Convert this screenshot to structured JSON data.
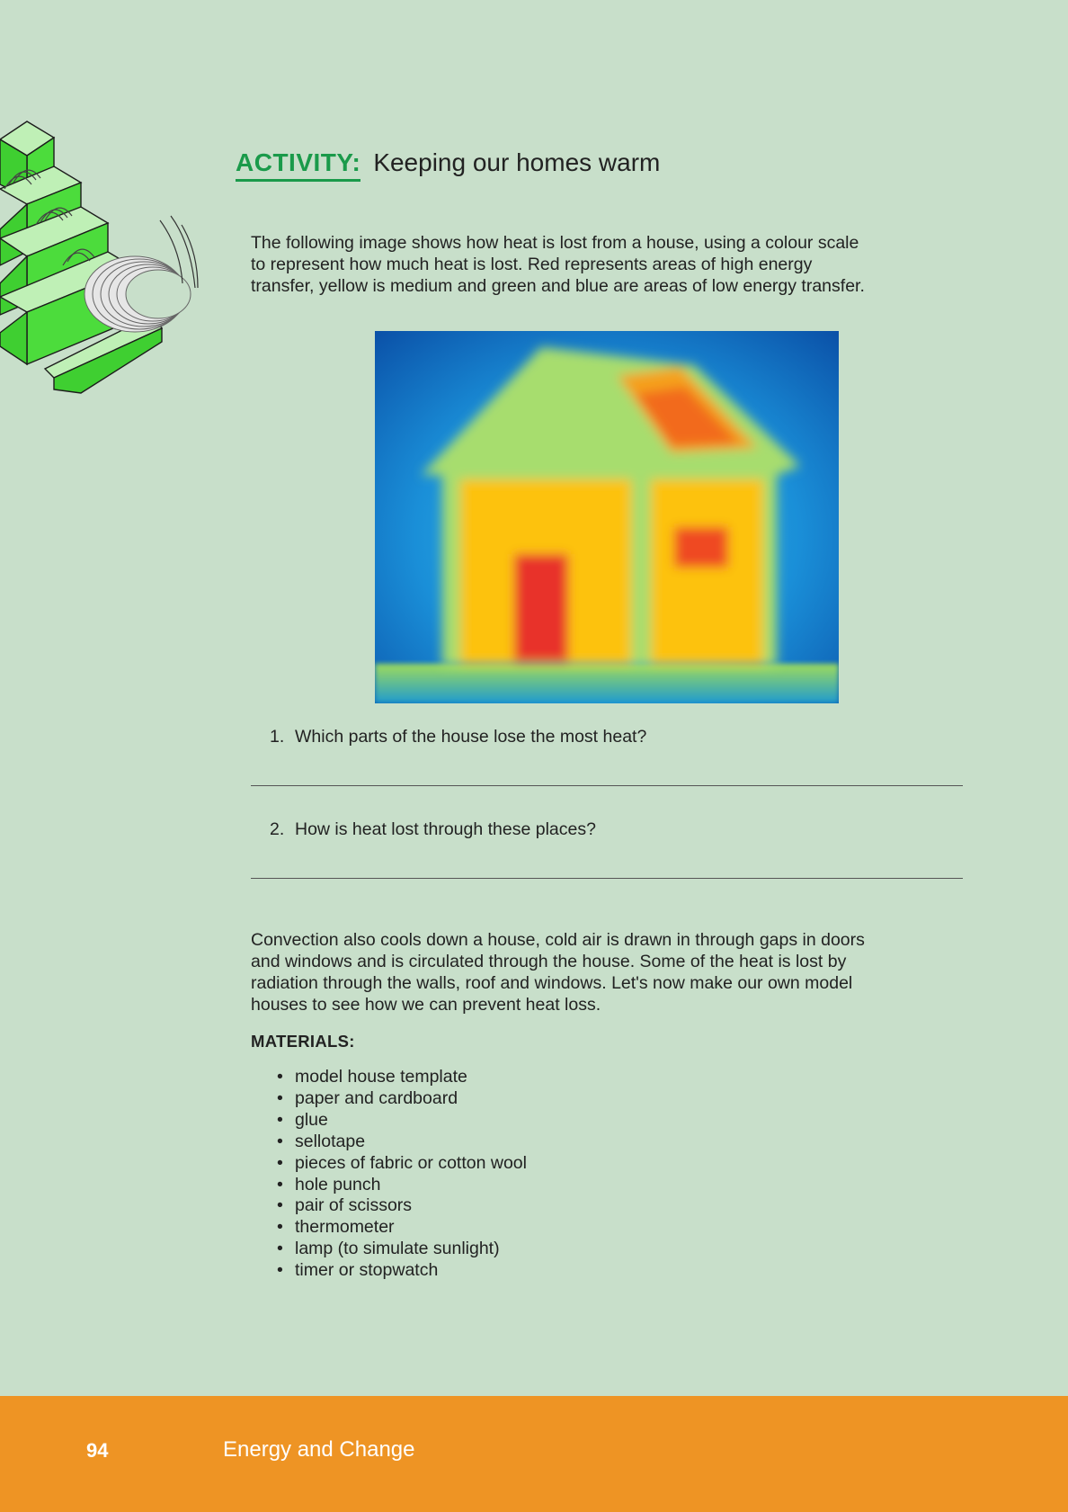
{
  "activity": {
    "label": "ACTIVITY:",
    "title": "Keeping our homes warm"
  },
  "intro_paragraph": [
    "The following image shows how heat is lost from a house, using a colour scale",
    "to represent how much heat is lost. Red represents areas of high energy",
    "transfer, yellow is medium and green and blue are areas of low energy transfer."
  ],
  "questions": [
    {
      "number": "1.",
      "text": "Which parts of the house lose the most heat?"
    },
    {
      "number": "2.",
      "text": "How is heat lost through these places?"
    }
  ],
  "convection_paragraph": [
    "Convection also cools down a house, cold air is drawn in through gaps in doors",
    "and windows and is circulated through the house. Some of the heat is lost by",
    "radiation through the walls, roof and windows. Let's now make our own model",
    "houses to see how we can prevent heat loss."
  ],
  "materials": {
    "heading": "MATERIALS:",
    "items": [
      "model house template",
      "paper and cardboard",
      "glue",
      "sellotape",
      "pieces of fabric or cotton wool",
      "hole punch",
      "pair of scissors",
      "thermometer",
      "lamp (to simulate sunlight)",
      "timer or stopwatch"
    ],
    "bullet": "•"
  },
  "footer": {
    "page_number": "94",
    "book_title": "Energy and Change"
  },
  "colors": {
    "background": "#c8dfca",
    "accent_green": "#1a9a4a",
    "footer_orange": "#ee9424"
  }
}
